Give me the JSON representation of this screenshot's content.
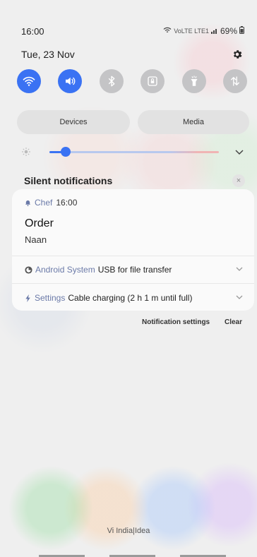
{
  "status_bar": {
    "time": "16:00",
    "signal_text": "VoLTE LTE1",
    "battery": "69%"
  },
  "header": {
    "date": "Tue, 23 Nov"
  },
  "quick_settings": [
    {
      "name": "wifi",
      "state": "on"
    },
    {
      "name": "sound",
      "state": "on"
    },
    {
      "name": "bluetooth",
      "state": "off"
    },
    {
      "name": "lock-rotation",
      "state": "off"
    },
    {
      "name": "flashlight",
      "state": "off"
    },
    {
      "name": "mobile-data",
      "state": "off"
    }
  ],
  "pills": {
    "devices": "Devices",
    "media": "Media"
  },
  "brightness": {
    "level_percent": 10
  },
  "silent_notifications": {
    "title": "Silent notifications",
    "close": "×"
  },
  "notification": {
    "app": "Chef",
    "time": "16:00",
    "title": "Order",
    "body": "Naan"
  },
  "rows": [
    {
      "source": "Android System",
      "text": "USB for file transfer"
    },
    {
      "source": "Settings",
      "text": "Cable charging (2 h 1 m until full)"
    }
  ],
  "footer": {
    "settings": "Notification settings",
    "clear": "Clear"
  },
  "carrier": "Vi India|Idea",
  "colors": {
    "accent": "#3a72f3",
    "inactive": "#c4c4c6"
  }
}
